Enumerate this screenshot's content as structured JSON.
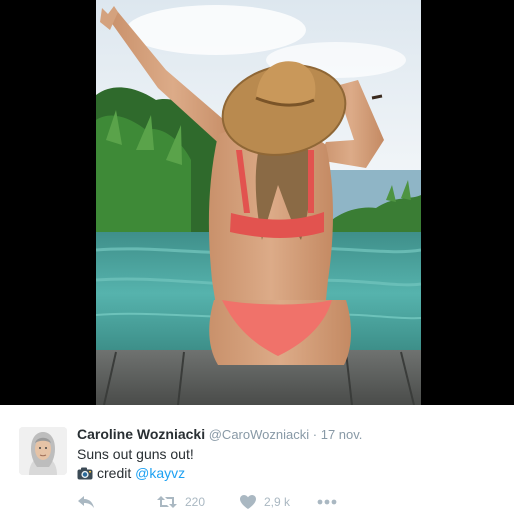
{
  "tweet": {
    "author": {
      "name": "Caroline Wozniacki",
      "handle": "@CaroWozniacki",
      "separator": "·",
      "timestamp": "17 nov."
    },
    "text_line_1": "Suns out guns out!",
    "text_line_2_prefix": "credit",
    "text_line_2_mention": "@kayvz",
    "media": {
      "icon": "camera-emoji"
    },
    "actions": {
      "reply_icon": "reply-icon",
      "retweet_icon": "retweet-icon",
      "retweet_count": "220",
      "like_icon": "heart-icon",
      "like_count": "2,9 k",
      "more_icon": "more-dots-icon"
    }
  },
  "colors": {
    "text_primary": "#292f33",
    "text_secondary": "#8899a6",
    "link": "#1da1f2",
    "action_icon": "#aab8c2",
    "media_letterbox": "#000000"
  }
}
